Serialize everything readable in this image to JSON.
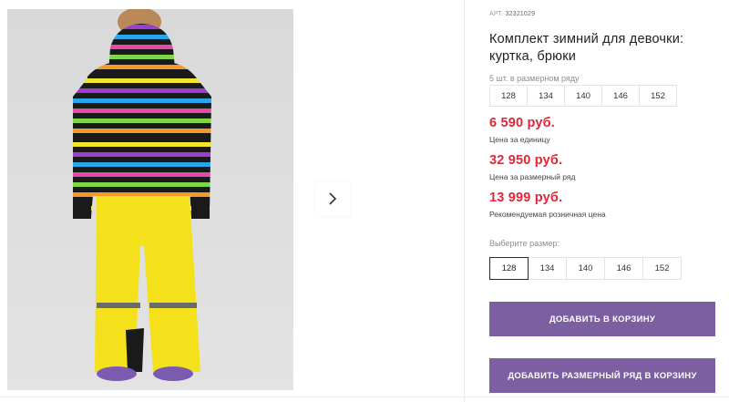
{
  "product": {
    "article_label": "АРТ.",
    "article_value": "32321029",
    "title": "Комплект зимний для девочки: куртка, брюки"
  },
  "size_row": {
    "caption": "5 шт. в размерном ряду",
    "sizes": [
      "128",
      "134",
      "140",
      "146",
      "152"
    ]
  },
  "prices": {
    "unit_price": "6 590 руб.",
    "unit_label": "Цена за единицу",
    "row_price": "32 950 руб.",
    "row_label": "Цена за размерный ряд",
    "retail_price": "13 999 руб.",
    "retail_label": "Рекомендуемая розничная цена"
  },
  "size_select": {
    "caption": "Выберите размер:",
    "sizes": [
      "128",
      "134",
      "140",
      "146",
      "152"
    ],
    "selected": "128"
  },
  "actions": {
    "add_to_cart": "ДОБАВИТЬ В КОРЗИНУ",
    "add_row_to_cart": "ДОБАВИТЬ РАЗМЕРНЫЙ РЯД В КОРЗИНУ"
  },
  "colors": {
    "price": "#e0263a",
    "button": "#7c5fa1"
  }
}
